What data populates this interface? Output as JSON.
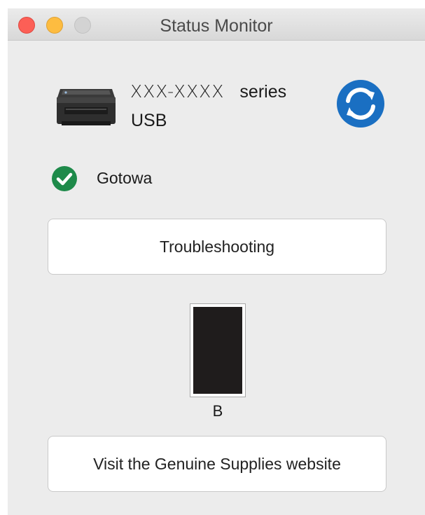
{
  "window": {
    "title": "Status Monitor"
  },
  "device": {
    "model": "XXX-XXXX",
    "series_label": "series",
    "connection": "USB"
  },
  "status": {
    "text": "Gotowa",
    "icon": "check-circle-icon",
    "color": "#1e8a4a"
  },
  "buttons": {
    "troubleshooting": "Troubleshooting",
    "supplies": "Visit the Genuine Supplies website"
  },
  "supplies": [
    {
      "label": "B",
      "level": 1.0,
      "color": "#1f1c1c"
    }
  ],
  "colors": {
    "refresh": "#1a6fc2"
  }
}
